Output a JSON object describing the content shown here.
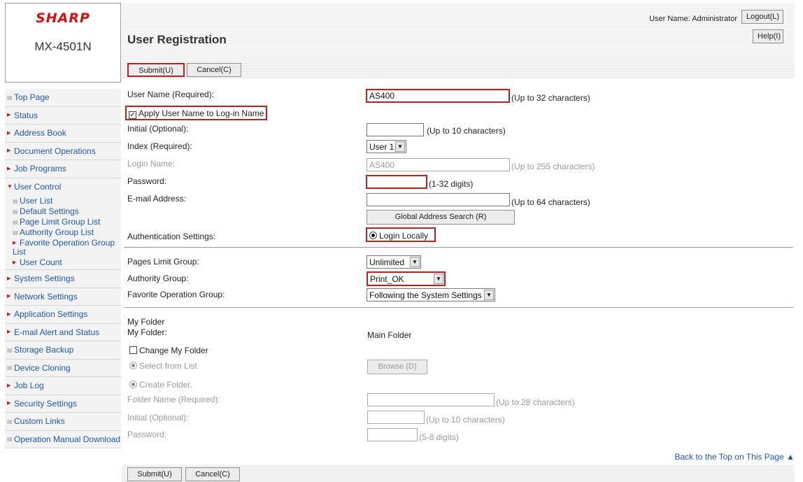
{
  "logo": {
    "brand": "SHARP",
    "model": "MX-4501N"
  },
  "header": {
    "user_label": "User Name: Administrator",
    "logout_label": "Logout(L)",
    "help_label": "Help(I)",
    "title": "User Registration"
  },
  "buttons": {
    "submit": "Submit(U)",
    "cancel": "Cancel(C)",
    "global_search": "Global Address Search (R)",
    "browse": "Browse (D)"
  },
  "sidebar": {
    "items": [
      {
        "label": "Top Page",
        "icon": "document-icon"
      },
      {
        "label": "Status",
        "icon": "arrow-right-icon"
      },
      {
        "label": "Address Book",
        "icon": "arrow-right-icon"
      },
      {
        "label": "Document Operations",
        "icon": "arrow-right-icon"
      },
      {
        "label": "Job Programs",
        "icon": "arrow-right-icon"
      },
      {
        "label": "User Control",
        "icon": "arrow-down-icon"
      },
      {
        "label": "System Settings",
        "icon": "arrow-right-icon"
      },
      {
        "label": "Network Settings",
        "icon": "arrow-right-icon"
      },
      {
        "label": "Application Settings",
        "icon": "arrow-right-icon"
      },
      {
        "label": "E-mail Alert and Status",
        "icon": "arrow-right-icon"
      },
      {
        "label": "Storage Backup",
        "icon": "document-icon"
      },
      {
        "label": "Device Cloning",
        "icon": "document-icon"
      },
      {
        "label": "Job Log",
        "icon": "arrow-right-icon"
      },
      {
        "label": "Security Settings",
        "icon": "arrow-right-icon"
      },
      {
        "label": "Custom Links",
        "icon": "document-icon"
      },
      {
        "label": "Operation Manual Download",
        "icon": "document-icon"
      }
    ],
    "user_control_sub": [
      {
        "label": "User List",
        "icon": "document-icon"
      },
      {
        "label": "Default Settings",
        "icon": "document-icon"
      },
      {
        "label": "Page Limit Group List",
        "icon": "document-icon"
      },
      {
        "label": "Authority Group List",
        "icon": "document-icon"
      },
      {
        "label": "Favorite Operation Group List",
        "icon": "arrow-right-icon"
      },
      {
        "label": "User Count",
        "icon": "arrow-right-icon"
      }
    ]
  },
  "form": {
    "user_name_label": "User Name (Required):",
    "user_name_value": "AS400",
    "user_name_hint": "(Up to 32 characters)",
    "apply_label": "Apply User Name to Log-in Name",
    "initial_label": "Initial (Optional):",
    "initial_hint": "(Up to 10 characters)",
    "index_label": "Index (Required):",
    "index_value": "User 1",
    "login_label": "Login Name:",
    "login_value": "AS400",
    "login_hint": "(Up to 255 characters)",
    "password_label": "Password:",
    "password_hint": "(1-32 digits)",
    "email_label": "E-mail Address:",
    "email_hint": "(Up to 64 characters)",
    "auth_label": "Authentication Settings:",
    "auth_value": "Login Locally",
    "pages_limit_label": "Pages Limit Group:",
    "pages_limit_value": "Unlimited",
    "authority_label": "Authority Group:",
    "authority_value": "Print_OK",
    "favorite_label": "Favorite Operation Group:",
    "favorite_value": "Following the System Settings",
    "my_folder_heading": "My Folder",
    "my_folder_label": "My Folder:",
    "my_folder_value": "Main Folder",
    "change_folder_label": "Change My Folder",
    "select_list_label": "Select from List",
    "create_folder_label": "Create Folder.",
    "folder_name_label": "Folder Name (Required):",
    "folder_name_hint": "(Up to 28 characters)",
    "folder_initial_label": "Initial (Optional):",
    "folder_initial_hint": "(Up to 10 characters)",
    "folder_password_label": "Password:",
    "folder_password_hint": "(5-8 digits)"
  },
  "back_to_top": "Back to the Top on This Page ▲"
}
